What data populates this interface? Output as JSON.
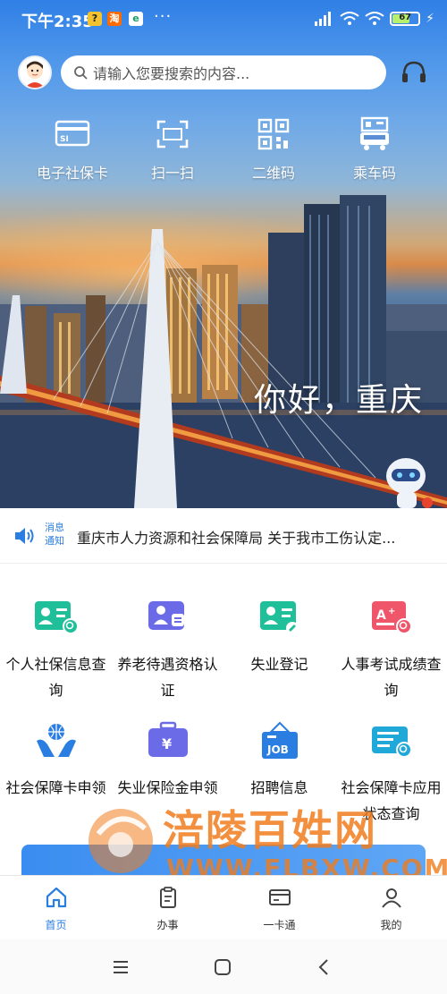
{
  "status_bar": {
    "time": "下午2:35",
    "app_icons": [
      {
        "name": "map-app-icon",
        "glyph": "?",
        "bg": "#f2c230"
      },
      {
        "name": "taobao-app-icon",
        "glyph": "淘",
        "bg": "#ff6a00"
      },
      {
        "name": "bank-app-icon",
        "glyph": "e",
        "bg": "#ffffff"
      }
    ],
    "more": "···",
    "battery": "67",
    "battery_level": 0.67
  },
  "header": {
    "search_placeholder": "请输入您要搜索的内容..."
  },
  "quick_actions": [
    {
      "label": "电子社保卡",
      "icon": "social-security-card-icon"
    },
    {
      "label": "扫一扫",
      "icon": "scan-icon"
    },
    {
      "label": "二维码",
      "icon": "qr-code-icon"
    },
    {
      "label": "乘车码",
      "icon": "bus-code-icon"
    }
  ],
  "banner": {
    "greeting": "你好，重庆"
  },
  "notice": {
    "tag": "消息通知",
    "text": "重庆市人力资源和社会保障局 关于我市工伤认定..."
  },
  "services": [
    {
      "label": "个人社保信息查询",
      "icon": "personal-social-security-icon",
      "color": "#1fbf9a"
    },
    {
      "label": "养老待遇资格认证",
      "icon": "pension-certification-icon",
      "color": "#6b6be8"
    },
    {
      "label": "失业登记",
      "icon": "unemployment-registration-icon",
      "color": "#1fbf9a"
    },
    {
      "label": "人事考试成绩查询",
      "icon": "exam-score-icon",
      "color": "#f0566a"
    },
    {
      "label": "社会保障卡申领",
      "icon": "social-card-apply-icon",
      "color": "#2a7de1"
    },
    {
      "label": "失业保险金申领",
      "icon": "unemployment-insurance-icon",
      "color": "#6b6be8"
    },
    {
      "label": "招聘信息",
      "icon": "job-recruitment-icon",
      "color": "#2a7de1"
    },
    {
      "label": "社会保障卡应用状态查询",
      "icon": "card-status-icon",
      "color": "#1fa8d8"
    }
  ],
  "watermark": {
    "title": "涪陵百姓网",
    "url": "WWW.FLBXW.COM"
  },
  "tab_bar": [
    {
      "label": "首页",
      "icon": "home-icon",
      "active": true
    },
    {
      "label": "办事",
      "icon": "clipboard-icon",
      "active": false
    },
    {
      "label": "一卡通",
      "icon": "card-icon",
      "active": false
    },
    {
      "label": "我的",
      "icon": "user-icon",
      "active": false
    }
  ],
  "colors": {
    "accent": "#2a7de1",
    "watermark": "#f07d1e"
  }
}
